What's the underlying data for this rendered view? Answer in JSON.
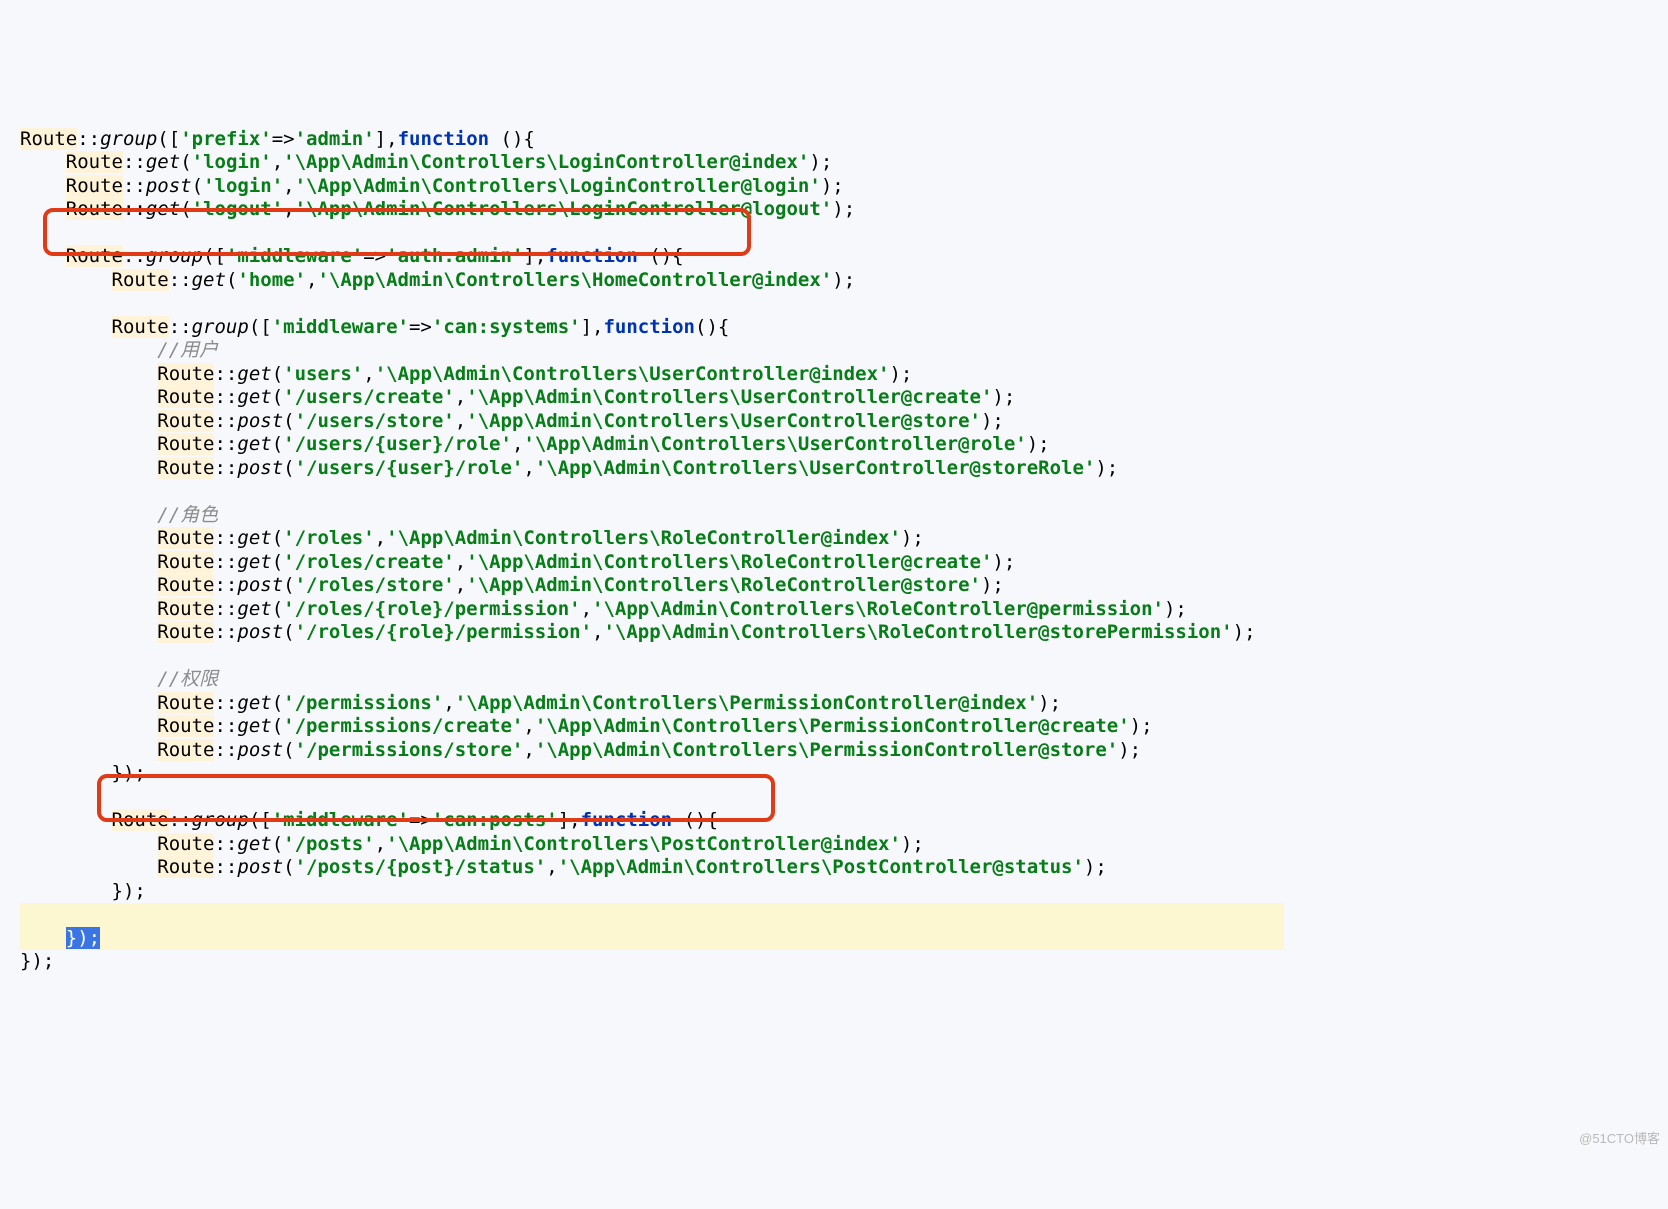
{
  "lines": {
    "l1": {
      "r": "Route",
      "dc": "::",
      "g": "group",
      "op": "([",
      "k": "'prefix'",
      "ar": "=>",
      "v": "'admin'",
      "cl": "],",
      "fn": "function ",
      "par": "(){"
    },
    "l2": {
      "r": "Route",
      "dc": "::",
      "g": "get",
      "op": "(",
      "a": "'login'",
      "c": ",",
      "b": "'\\App\\Admin\\Controllers\\LoginController@index'",
      "cl": ");"
    },
    "l3": {
      "r": "Route",
      "dc": "::",
      "g": "post",
      "op": "(",
      "a": "'login'",
      "c": ",",
      "b": "'\\App\\Admin\\Controllers\\LoginController@login'",
      "cl": ");"
    },
    "l4": {
      "r": "Route",
      "dc": "::",
      "g": "get",
      "op": "(",
      "a": "'logout'",
      "c": ",",
      "b": "'\\App\\Admin\\Controllers\\LoginController@logout'",
      "cl": ");"
    },
    "l5": {
      "r": "Route",
      "dc": "::",
      "g": "group",
      "op": "([",
      "k": "'middleware'",
      "ar": "=>",
      "v": "'auth:admin'",
      "cl": "],",
      "fn": "function ",
      "par": "(){"
    },
    "l6": {
      "r": "Route",
      "dc": "::",
      "g": "get",
      "op": "(",
      "a": "'home'",
      "c": ",",
      "b": "'\\App\\Admin\\Controllers\\HomeController@index'",
      "cl": ");"
    },
    "l7": {
      "r": "Route",
      "dc": "::",
      "g": "group",
      "op": "([",
      "k": "'middleware'",
      "ar": "=>",
      "v": "'can:systems'",
      "cl": "],",
      "fn": "function",
      "par": "(){"
    },
    "c1": "//用户",
    "l8": {
      "r": "Route",
      "dc": "::",
      "g": "get",
      "op": "(",
      "a": "'users'",
      "c": ",",
      "b": "'\\App\\Admin\\Controllers\\UserController@index'",
      "cl": ");"
    },
    "l9": {
      "r": "Route",
      "dc": "::",
      "g": "get",
      "op": "(",
      "a": "'/users/create'",
      "c": ",",
      "b": "'\\App\\Admin\\Controllers\\UserController@create'",
      "cl": ");"
    },
    "l10": {
      "r": "Route",
      "dc": "::",
      "g": "post",
      "op": "(",
      "a": "'/users/store'",
      "c": ",",
      "b": "'\\App\\Admin\\Controllers\\UserController@store'",
      "cl": ");"
    },
    "l11": {
      "r": "Route",
      "dc": "::",
      "g": "get",
      "op": "(",
      "a": "'/users/{user}/role'",
      "c": ",",
      "b": "'\\App\\Admin\\Controllers\\UserController@role'",
      "cl": ");"
    },
    "l12": {
      "r": "Route",
      "dc": "::",
      "g": "post",
      "op": "(",
      "a": "'/users/{user}/role'",
      "c": ",",
      "b": "'\\App\\Admin\\Controllers\\UserController@storeRole'",
      "cl": ");"
    },
    "c2": "//角色",
    "l13": {
      "r": "Route",
      "dc": "::",
      "g": "get",
      "op": "(",
      "a": "'/roles'",
      "c": ",",
      "b": "'\\App\\Admin\\Controllers\\RoleController@index'",
      "cl": ");"
    },
    "l14": {
      "r": "Route",
      "dc": "::",
      "g": "get",
      "op": "(",
      "a": "'/roles/create'",
      "c": ",",
      "b": "'\\App\\Admin\\Controllers\\RoleController@create'",
      "cl": ");"
    },
    "l15": {
      "r": "Route",
      "dc": "::",
      "g": "post",
      "op": "(",
      "a": "'/roles/store'",
      "c": ",",
      "b": "'\\App\\Admin\\Controllers\\RoleController@store'",
      "cl": ");"
    },
    "l16": {
      "r": "Route",
      "dc": "::",
      "g": "get",
      "op": "(",
      "a": "'/roles/{role}/permission'",
      "c": ",",
      "b": "'\\App\\Admin\\Controllers\\RoleController@permission'",
      "cl": ");"
    },
    "l17": {
      "r": "Route",
      "dc": "::",
      "g": "post",
      "op": "(",
      "a": "'/roles/{role}/permission'",
      "c": ",",
      "b": "'\\App\\Admin\\Controllers\\RoleController@storePermission'",
      "cl": ");"
    },
    "c3": "//权限",
    "l18": {
      "r": "Route",
      "dc": "::",
      "g": "get",
      "op": "(",
      "a": "'/permissions'",
      "c": ",",
      "b": "'\\App\\Admin\\Controllers\\PermissionController@index'",
      "cl": ");"
    },
    "l19": {
      "r": "Route",
      "dc": "::",
      "g": "get",
      "op": "(",
      "a": "'/permissions/create'",
      "c": ",",
      "b": "'\\App\\Admin\\Controllers\\PermissionController@create'",
      "cl": ");"
    },
    "l20": {
      "r": "Route",
      "dc": "::",
      "g": "post",
      "op": "(",
      "a": "'/permissions/store'",
      "c": ",",
      "b": "'\\App\\Admin\\Controllers\\PermissionController@store'",
      "cl": ");"
    },
    "close1": "});",
    "l21": {
      "r": "Route",
      "dc": "::",
      "g": "group",
      "op": "([",
      "k": "'middleware'",
      "ar": "=>",
      "v": "'can:posts'",
      "cl": "],",
      "fn": "function ",
      "par": "(){"
    },
    "l22": {
      "r": "Route",
      "dc": "::",
      "g": "get",
      "op": "(",
      "a": "'/posts'",
      "c": ",",
      "b": "'\\App\\Admin\\Controllers\\PostController@index'",
      "cl": ");"
    },
    "l23": {
      "r": "Route",
      "dc": "::",
      "g": "post",
      "op": "(",
      "a": "'/posts/{post}/status'",
      "c": ",",
      "b": "'\\App\\Admin\\Controllers\\PostController@status'",
      "cl": ");"
    },
    "close2": "});",
    "close3": "});",
    "close4": "});"
  },
  "watermark": "@51CTO博客"
}
